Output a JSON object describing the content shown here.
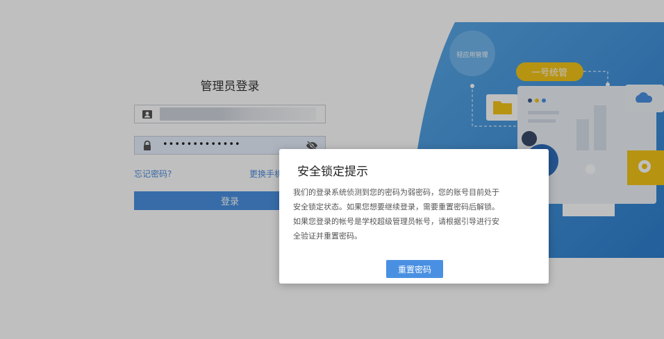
{
  "login": {
    "title": "管理员登录",
    "password_mask": "•••••••••••••",
    "forgot_label": "忘记密码?",
    "switch_label": "更换手机",
    "login_button": "登录"
  },
  "illustration": {
    "bubble_label": "轻应用管理",
    "banner_label": "一号统管"
  },
  "dialog": {
    "title": "安全锁定提示",
    "lines": [
      "我们的登录系统侦测到您的密码为弱密码，您的账号目前处于",
      "安全锁定状态。如果您想要继续登录，需要重置密码后解锁。",
      "如果您登录的帐号是学校超级管理员帐号，请根据引导进行安",
      "全验证并重置密码。"
    ],
    "button": "重置密码"
  },
  "colors": {
    "accent": "#4a90e2",
    "link": "#4a8cdf",
    "banner": "#f5c518"
  }
}
